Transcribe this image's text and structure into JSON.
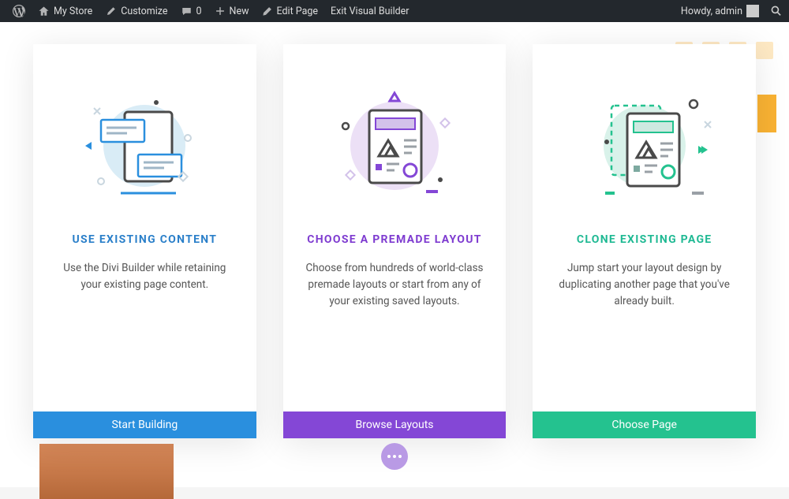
{
  "adminbar": {
    "items": [
      {
        "label": "",
        "icon": "wp"
      },
      {
        "label": "My Store",
        "icon": "home"
      },
      {
        "label": "Customize",
        "icon": "brush"
      },
      {
        "label": "0",
        "icon": "comment"
      },
      {
        "label": "New",
        "icon": "plus"
      },
      {
        "label": "Edit Page",
        "icon": "pencil"
      },
      {
        "label": "Exit Visual Builder",
        "icon": ""
      }
    ],
    "greeting": "Howdy, admin"
  },
  "cards": [
    {
      "title": "USE EXISTING CONTENT",
      "desc": "Use the Divi Builder while retaining your existing page content.",
      "button": "Start Building",
      "color": "blue"
    },
    {
      "title": "CHOOSE A PREMADE LAYOUT",
      "desc": "Choose from hundreds of world-class premade layouts or start from any of your existing saved layouts.",
      "button": "Browse Layouts",
      "color": "purple"
    },
    {
      "title": "CLONE EXISTING PAGE",
      "desc": "Jump start your layout design by duplicating another page that you've already built.",
      "button": "Choose Page",
      "color": "teal"
    }
  ]
}
